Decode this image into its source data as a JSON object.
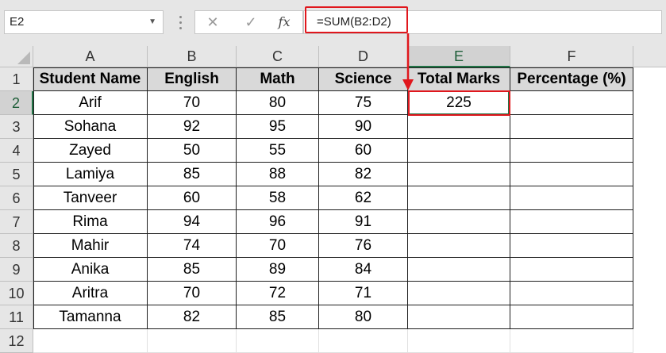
{
  "name_box": {
    "value": "E2"
  },
  "formula_bar": {
    "cancel_icon": "close-icon",
    "enter_icon": "check-icon",
    "fx_label": "fx",
    "formula": "=SUM(B2:D2)"
  },
  "columns": [
    "A",
    "B",
    "C",
    "D",
    "E",
    "F"
  ],
  "rows": [
    "1",
    "2",
    "3",
    "4",
    "5",
    "6",
    "7",
    "8",
    "9",
    "10",
    "11",
    "12"
  ],
  "active_cell": "E2",
  "accent_colors": {
    "highlight": "#e0171d",
    "excel_green": "#217346",
    "header_fill": "#d9d9d9"
  },
  "table": {
    "headers": [
      "Student Name",
      "English",
      "Math",
      "Science",
      "Total Marks",
      "Percentage (%)"
    ],
    "rows": [
      [
        "Arif",
        "70",
        "80",
        "75",
        "225",
        ""
      ],
      [
        "Sohana",
        "92",
        "95",
        "90",
        "",
        ""
      ],
      [
        "Zayed",
        "50",
        "55",
        "60",
        "",
        ""
      ],
      [
        "Lamiya",
        "85",
        "88",
        "82",
        "",
        ""
      ],
      [
        "Tanveer",
        "60",
        "58",
        "62",
        "",
        ""
      ],
      [
        "Rima",
        "94",
        "96",
        "91",
        "",
        ""
      ],
      [
        "Mahir",
        "74",
        "70",
        "76",
        "",
        ""
      ],
      [
        "Anika",
        "85",
        "89",
        "84",
        "",
        ""
      ],
      [
        "Aritra",
        "70",
        "72",
        "71",
        "",
        ""
      ],
      [
        "Tamanna",
        "82",
        "85",
        "80",
        "",
        ""
      ]
    ]
  }
}
